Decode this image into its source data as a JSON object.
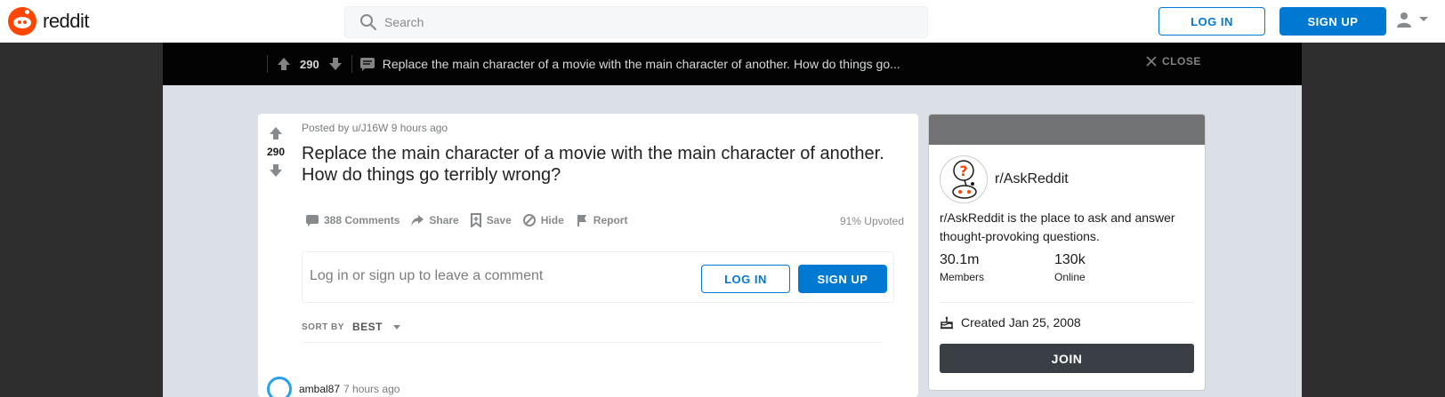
{
  "header": {
    "logo_text": "reddit",
    "search_placeholder": "Search",
    "login_label": "LOG IN",
    "signup_label": "SIGN UP"
  },
  "post_bar": {
    "score": "290",
    "title": "Replace the main character of a movie with the main character of another. How do things go...",
    "close_label": "CLOSE"
  },
  "post": {
    "score": "290",
    "meta": "Posted by u/J16W 9 hours ago",
    "title": "Replace the main character of a movie with the main character of another. How do things go terribly wrong?",
    "actions": {
      "comments": "388 Comments",
      "share": "Share",
      "save": "Save",
      "hide": "Hide",
      "report": "Report"
    },
    "upvoted": "91% Upvoted"
  },
  "comment_box": {
    "prompt": "Log in or sign up to leave a comment",
    "login_label": "LOG IN",
    "signup_label": "SIGN UP"
  },
  "sort": {
    "label": "SORT BY",
    "value": "BEST"
  },
  "first_comment": {
    "author": "ambal87",
    "time": "7 hours ago"
  },
  "sidebar": {
    "name": "r/AskReddit",
    "description": "r/AskReddit is the place to ask and answer thought-provoking questions.",
    "members_count": "30.1m",
    "members_label": "Members",
    "online_count": "130k",
    "online_label": "Online",
    "created": "Created Jan 25, 2008",
    "join_label": "JOIN"
  },
  "colors": {
    "brand": "#ff4500",
    "accent": "#0079d3",
    "join_button": "#3a3f45"
  }
}
